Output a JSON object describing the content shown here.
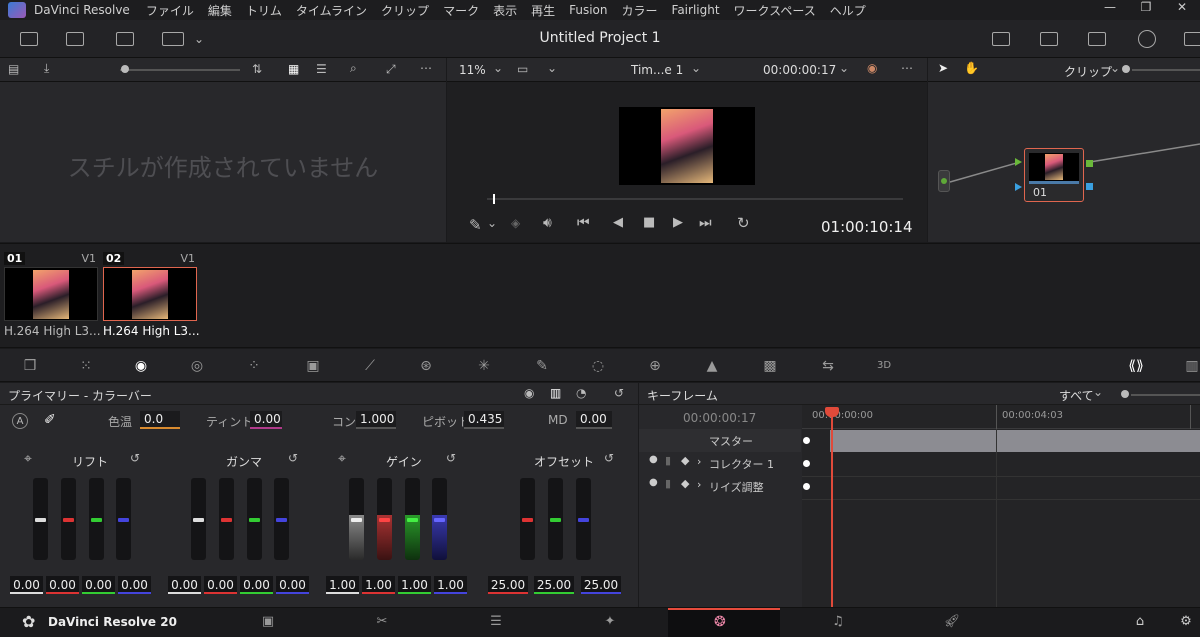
{
  "menubar": {
    "app_name": "DaVinci Resolve",
    "items": [
      "ファイル",
      "編集",
      "トリム",
      "タイムライン",
      "クリップ",
      "マーク",
      "表示",
      "再生",
      "Fusion",
      "カラー",
      "Fairlight",
      "ワークスペース",
      "ヘルプ"
    ],
    "window_buttons": [
      "—",
      "❐",
      "✕"
    ]
  },
  "toolbar": {
    "project_title": "Untitled Project 1"
  },
  "gallery": {
    "empty_message": "スチルが作成されていません"
  },
  "viewer": {
    "zoom": "11%",
    "timeline_name": "Tim...e 1",
    "timecode_top": "00:00:00:17",
    "timecode_playhead": "01:00:10:14"
  },
  "nodes": {
    "mode": "クリップ",
    "node_label": "01"
  },
  "clips": [
    {
      "number": "01",
      "track": "V1",
      "name": "H.264 High L3...",
      "selected": false
    },
    {
      "number": "02",
      "track": "V1",
      "name": "H.264 High L3...",
      "selected": true
    }
  ],
  "primary": {
    "title": "プライマリー - カラーバー",
    "params": {
      "temp_label": "色温",
      "temp_value": "0.0",
      "tint_label": "ティント",
      "tint_value": "0.00",
      "contrast_label": "コン",
      "contrast_value": "1.000",
      "pivot_label": "ピボット",
      "pivot_value": "0.435",
      "md_label": "MD",
      "md_value": "0.00"
    },
    "wheels": [
      {
        "name": "リフト",
        "values": [
          "0.00",
          "0.00",
          "0.00",
          "0.00"
        ]
      },
      {
        "name": "ガンマ",
        "values": [
          "0.00",
          "0.00",
          "0.00",
          "0.00"
        ]
      },
      {
        "name": "ゲイン",
        "values": [
          "1.00",
          "1.00",
          "1.00",
          "1.00"
        ]
      },
      {
        "name": "オフセット",
        "values": [
          "25.00",
          "25.00",
          "25.00"
        ]
      }
    ]
  },
  "keyframes": {
    "title": "キーフレーム",
    "filter": "すべて",
    "current_time": "00:00:00:17",
    "ruler": [
      "00:00:00:00",
      "00:00:04:03"
    ],
    "rows": [
      "マスター",
      "コレクター 1",
      "リイズ調整"
    ]
  },
  "bottombar": {
    "app_version": "DaVinci Resolve 20"
  },
  "colors": {
    "accent": "#e64b3c",
    "selected_border": "#e0664f",
    "playhead": "#e04a3a"
  }
}
